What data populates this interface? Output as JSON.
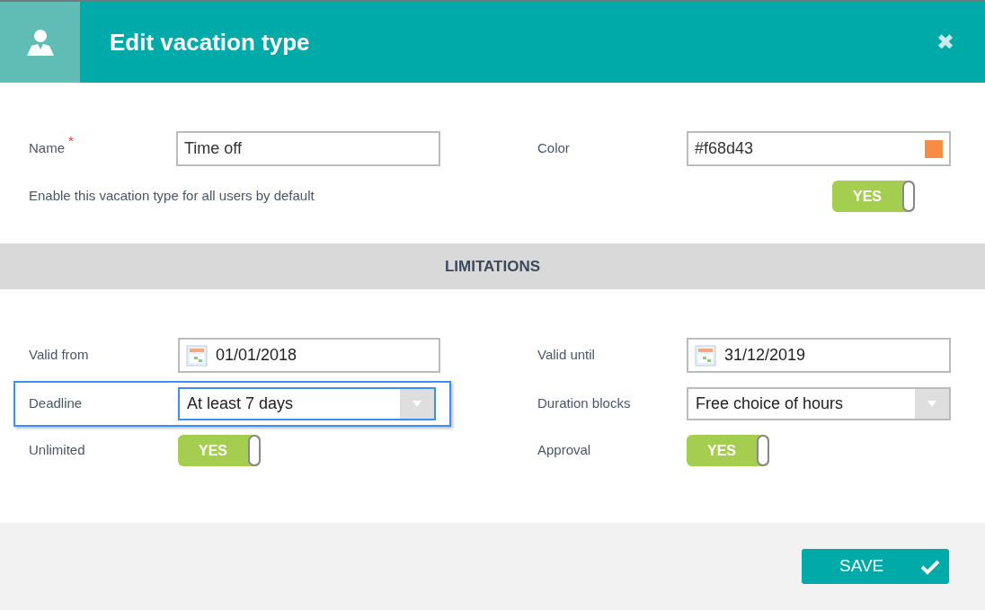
{
  "dialog": {
    "title": "Edit vacation type",
    "close": "✖"
  },
  "general": {
    "name": {
      "label": "Name",
      "required_mark": "*",
      "value": "Time off"
    },
    "color": {
      "label": "Color",
      "value": "#f68d43"
    },
    "enable_default": {
      "label": "Enable this vacation type for all users by default",
      "on": true,
      "text": "YES"
    }
  },
  "limitations": {
    "heading": "LIMITATIONS",
    "fields": [
      {
        "kind": "date",
        "label": "Valid from",
        "value": "01/01/2018",
        "focused": false
      },
      {
        "kind": "date",
        "label": "Valid until",
        "value": "31/12/2019",
        "focused": false
      },
      {
        "kind": "select",
        "label": "Deadline",
        "value": "At least 7 days",
        "focused": true
      },
      {
        "kind": "select",
        "label": "Duration blocks",
        "value": "Free choice of hours",
        "focused": false
      },
      {
        "kind": "toggle",
        "label": "Unlimited",
        "on": true,
        "text": "YES",
        "focused": false
      },
      {
        "kind": "toggle",
        "label": "Approval",
        "on": true,
        "text": "YES",
        "focused": false
      }
    ]
  },
  "footer": {
    "save": "SAVE"
  }
}
